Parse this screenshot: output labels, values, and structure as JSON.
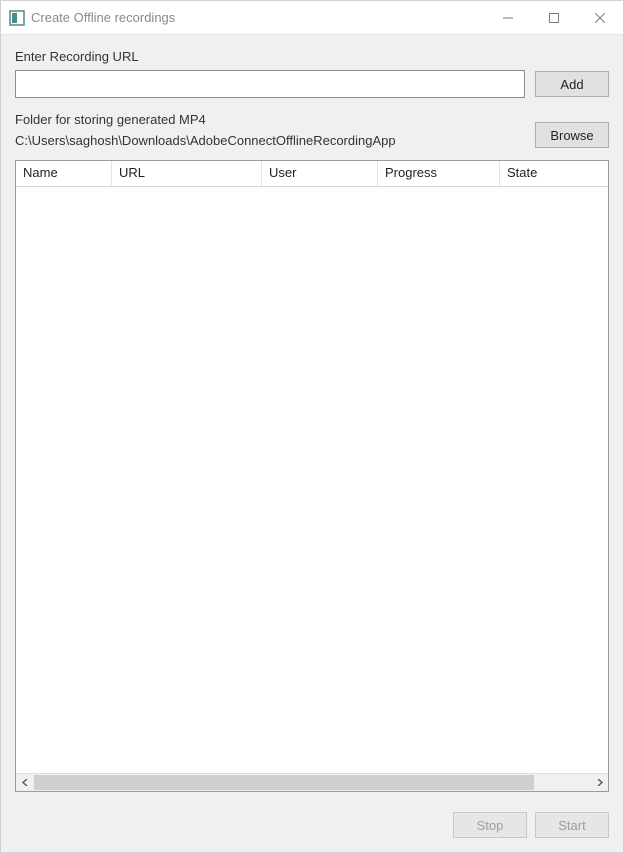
{
  "window": {
    "title": "Create Offline recordings"
  },
  "form": {
    "url_label": "Enter Recording URL",
    "url_value": "",
    "add_label": "Add",
    "folder_label": "Folder for storing generated MP4",
    "folder_path": "C:\\Users\\saghosh\\Downloads\\AdobeConnectOfflineRecordingApp",
    "browse_label": "Browse"
  },
  "grid": {
    "columns": {
      "name": "Name",
      "url": "URL",
      "user": "User",
      "progress": "Progress",
      "state": "State"
    },
    "rows": []
  },
  "footer": {
    "stop_label": "Stop",
    "start_label": "Start"
  }
}
